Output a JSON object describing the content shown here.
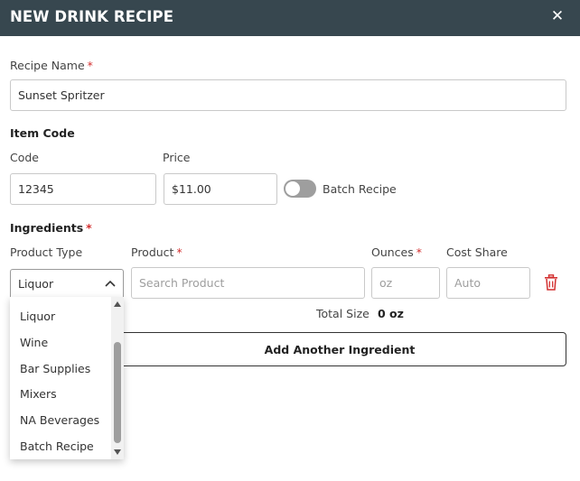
{
  "header": {
    "title": "NEW DRINK RECIPE",
    "close_symbol": "✕"
  },
  "recipe_name": {
    "label": "Recipe Name",
    "required_mark": "*",
    "value": "Sunset Spritzer"
  },
  "item_code": {
    "section_title": "Item Code",
    "code_label": "Code",
    "code_value": "12345",
    "price_label": "Price",
    "price_value": "$11.00",
    "batch_label": "Batch Recipe",
    "batch_on": false
  },
  "ingredients": {
    "section_title": "Ingredients",
    "required_mark": "*",
    "columns": {
      "product_type": "Product Type",
      "product": "Product",
      "ounces": "Ounces",
      "cost_share": "Cost Share"
    },
    "row": {
      "product_type_value": "Liquor",
      "product_placeholder": "Search Product",
      "ounces_placeholder": "oz",
      "cost_share_placeholder": "Auto"
    },
    "dropdown_options": [
      "Liquor",
      "Wine",
      "Bar Supplies",
      "Mixers",
      "NA Beverages",
      "Batch Recipe"
    ],
    "total_size_label": "Total Size",
    "total_size_value": "0 oz",
    "add_button_label": "Add Another Ingredient"
  },
  "colors": {
    "header_bg": "#37474f",
    "required": "#d32f2f",
    "trash": "#d32f2f",
    "toggle_off": "#9e9e9e"
  },
  "icons": [
    "close-icon",
    "chevron-up-icon",
    "trash-icon"
  ]
}
